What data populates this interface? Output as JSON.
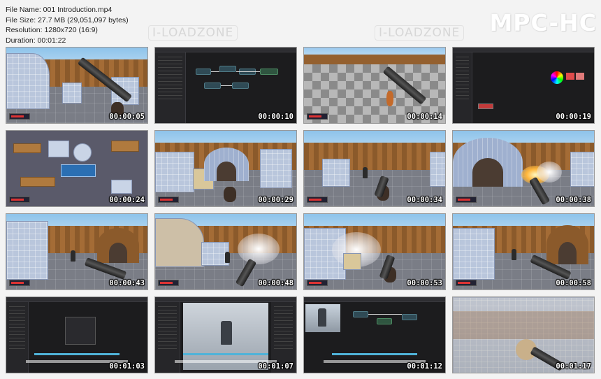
{
  "file_info": {
    "name": "File Name: 001 Introduction.mp4",
    "size": "File Size: 27.7 MB (29,051,097 bytes)",
    "resolution": "Resolution: 1280x720 (16:9)",
    "duration": "Duration: 00:01:22"
  },
  "brand": "MPC-HC",
  "watermark": "I-LOADZONE",
  "thumbnails": [
    {
      "time": "00:00:05"
    },
    {
      "time": "00:00:10"
    },
    {
      "time": "00:00:14"
    },
    {
      "time": "00:00:19"
    },
    {
      "time": "00:00:24"
    },
    {
      "time": "00:00:29"
    },
    {
      "time": "00:00:34"
    },
    {
      "time": "00:00:38"
    },
    {
      "time": "00:00:43"
    },
    {
      "time": "00:00:48"
    },
    {
      "time": "00:00:53"
    },
    {
      "time": "00:00:58"
    },
    {
      "time": "00:01:03"
    },
    {
      "time": "00:01:07"
    },
    {
      "time": "00:01:12"
    },
    {
      "time": "00:01:17"
    }
  ]
}
